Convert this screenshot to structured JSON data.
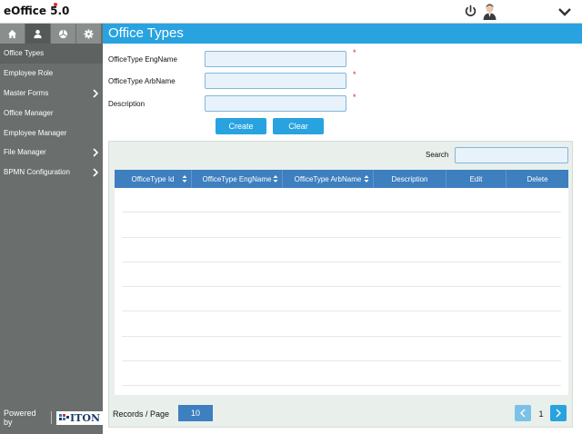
{
  "app": {
    "title": "eOffice 5.0"
  },
  "header": {
    "power_icon": "power-icon",
    "avatar_icon": "user-avatar",
    "menu_icon": "chevron-down-icon"
  },
  "sidebar": {
    "tabs": [
      {
        "icon": "home-icon"
      },
      {
        "icon": "user-icon"
      },
      {
        "icon": "cube-icon"
      },
      {
        "icon": "gear-icon"
      }
    ],
    "items": [
      {
        "label": "Office Types",
        "has_arrow": false
      },
      {
        "label": "Employee Role",
        "has_arrow": false
      },
      {
        "label": "Master Forms",
        "has_arrow": true
      },
      {
        "label": "Office Manager",
        "has_arrow": false
      },
      {
        "label": "Employee Manager",
        "has_arrow": false
      },
      {
        "label": "File Manager",
        "has_arrow": true
      },
      {
        "label": "BPMN Configuration",
        "has_arrow": true
      }
    ],
    "powered_by": "Powered by",
    "logo_text": "ITON"
  },
  "page": {
    "title": "Office Types",
    "form": {
      "eng_name_label": "OfficeType EngName",
      "eng_name_value": "",
      "arb_name_label": "OfficeType ArbName",
      "arb_name_value": "",
      "description_label": "Description",
      "description_value": "",
      "required_mark": "*"
    },
    "buttons": {
      "create": "Create",
      "clear": "Clear"
    },
    "grid": {
      "search_label": "Search",
      "search_value": "",
      "columns": [
        "OfficeType Id",
        "OfficeType EngName",
        "OfficeType ArbName",
        "Description",
        "Edit",
        "Delete"
      ],
      "rows": [],
      "records_per_page_label": "Records / Page",
      "records_per_page_value": "10",
      "current_page": "1"
    }
  },
  "colors": {
    "accent": "#28a3e0",
    "table_header": "#3d7fbf",
    "sidebar": "#6a6e6d",
    "required": "#e02020"
  }
}
